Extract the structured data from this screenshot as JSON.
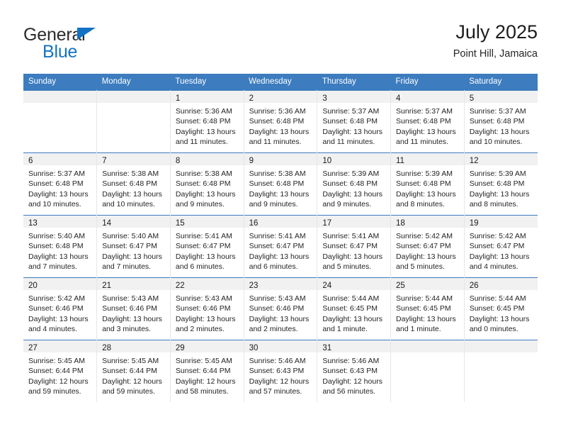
{
  "brand": {
    "line1": "General",
    "line2": "Blue",
    "triangle_color": "#1472c4",
    "text_color": "#2b2b2b"
  },
  "header": {
    "title": "July 2025",
    "subtitle": "Point Hill, Jamaica"
  },
  "theme": {
    "header_bg": "#3c7cbf",
    "header_text": "#ffffff",
    "daynum_band_bg": "#f1f1f1",
    "cell_bg": "#ffffff",
    "row_divider": "#3c7cbf",
    "col_divider": "#e6e6e6"
  },
  "weekday_headers": [
    "Sunday",
    "Monday",
    "Tuesday",
    "Wednesday",
    "Thursday",
    "Friday",
    "Saturday"
  ],
  "weeks": [
    [
      {
        "day": "",
        "empty": true,
        "sunrise": "",
        "sunset": "",
        "daylight_line1": "",
        "daylight_line2": ""
      },
      {
        "day": "",
        "empty": true,
        "sunrise": "",
        "sunset": "",
        "daylight_line1": "",
        "daylight_line2": ""
      },
      {
        "day": "1",
        "sunrise": "Sunrise: 5:36 AM",
        "sunset": "Sunset: 6:48 PM",
        "daylight_line1": "Daylight: 13 hours",
        "daylight_line2": "and 11 minutes."
      },
      {
        "day": "2",
        "sunrise": "Sunrise: 5:36 AM",
        "sunset": "Sunset: 6:48 PM",
        "daylight_line1": "Daylight: 13 hours",
        "daylight_line2": "and 11 minutes."
      },
      {
        "day": "3",
        "sunrise": "Sunrise: 5:37 AM",
        "sunset": "Sunset: 6:48 PM",
        "daylight_line1": "Daylight: 13 hours",
        "daylight_line2": "and 11 minutes."
      },
      {
        "day": "4",
        "sunrise": "Sunrise: 5:37 AM",
        "sunset": "Sunset: 6:48 PM",
        "daylight_line1": "Daylight: 13 hours",
        "daylight_line2": "and 11 minutes."
      },
      {
        "day": "5",
        "sunrise": "Sunrise: 5:37 AM",
        "sunset": "Sunset: 6:48 PM",
        "daylight_line1": "Daylight: 13 hours",
        "daylight_line2": "and 10 minutes."
      }
    ],
    [
      {
        "day": "6",
        "sunrise": "Sunrise: 5:37 AM",
        "sunset": "Sunset: 6:48 PM",
        "daylight_line1": "Daylight: 13 hours",
        "daylight_line2": "and 10 minutes."
      },
      {
        "day": "7",
        "sunrise": "Sunrise: 5:38 AM",
        "sunset": "Sunset: 6:48 PM",
        "daylight_line1": "Daylight: 13 hours",
        "daylight_line2": "and 10 minutes."
      },
      {
        "day": "8",
        "sunrise": "Sunrise: 5:38 AM",
        "sunset": "Sunset: 6:48 PM",
        "daylight_line1": "Daylight: 13 hours",
        "daylight_line2": "and 9 minutes."
      },
      {
        "day": "9",
        "sunrise": "Sunrise: 5:38 AM",
        "sunset": "Sunset: 6:48 PM",
        "daylight_line1": "Daylight: 13 hours",
        "daylight_line2": "and 9 minutes."
      },
      {
        "day": "10",
        "sunrise": "Sunrise: 5:39 AM",
        "sunset": "Sunset: 6:48 PM",
        "daylight_line1": "Daylight: 13 hours",
        "daylight_line2": "and 9 minutes."
      },
      {
        "day": "11",
        "sunrise": "Sunrise: 5:39 AM",
        "sunset": "Sunset: 6:48 PM",
        "daylight_line1": "Daylight: 13 hours",
        "daylight_line2": "and 8 minutes."
      },
      {
        "day": "12",
        "sunrise": "Sunrise: 5:39 AM",
        "sunset": "Sunset: 6:48 PM",
        "daylight_line1": "Daylight: 13 hours",
        "daylight_line2": "and 8 minutes."
      }
    ],
    [
      {
        "day": "13",
        "sunrise": "Sunrise: 5:40 AM",
        "sunset": "Sunset: 6:48 PM",
        "daylight_line1": "Daylight: 13 hours",
        "daylight_line2": "and 7 minutes."
      },
      {
        "day": "14",
        "sunrise": "Sunrise: 5:40 AM",
        "sunset": "Sunset: 6:47 PM",
        "daylight_line1": "Daylight: 13 hours",
        "daylight_line2": "and 7 minutes."
      },
      {
        "day": "15",
        "sunrise": "Sunrise: 5:41 AM",
        "sunset": "Sunset: 6:47 PM",
        "daylight_line1": "Daylight: 13 hours",
        "daylight_line2": "and 6 minutes."
      },
      {
        "day": "16",
        "sunrise": "Sunrise: 5:41 AM",
        "sunset": "Sunset: 6:47 PM",
        "daylight_line1": "Daylight: 13 hours",
        "daylight_line2": "and 6 minutes."
      },
      {
        "day": "17",
        "sunrise": "Sunrise: 5:41 AM",
        "sunset": "Sunset: 6:47 PM",
        "daylight_line1": "Daylight: 13 hours",
        "daylight_line2": "and 5 minutes."
      },
      {
        "day": "18",
        "sunrise": "Sunrise: 5:42 AM",
        "sunset": "Sunset: 6:47 PM",
        "daylight_line1": "Daylight: 13 hours",
        "daylight_line2": "and 5 minutes."
      },
      {
        "day": "19",
        "sunrise": "Sunrise: 5:42 AM",
        "sunset": "Sunset: 6:47 PM",
        "daylight_line1": "Daylight: 13 hours",
        "daylight_line2": "and 4 minutes."
      }
    ],
    [
      {
        "day": "20",
        "sunrise": "Sunrise: 5:42 AM",
        "sunset": "Sunset: 6:46 PM",
        "daylight_line1": "Daylight: 13 hours",
        "daylight_line2": "and 4 minutes."
      },
      {
        "day": "21",
        "sunrise": "Sunrise: 5:43 AM",
        "sunset": "Sunset: 6:46 PM",
        "daylight_line1": "Daylight: 13 hours",
        "daylight_line2": "and 3 minutes."
      },
      {
        "day": "22",
        "sunrise": "Sunrise: 5:43 AM",
        "sunset": "Sunset: 6:46 PM",
        "daylight_line1": "Daylight: 13 hours",
        "daylight_line2": "and 2 minutes."
      },
      {
        "day": "23",
        "sunrise": "Sunrise: 5:43 AM",
        "sunset": "Sunset: 6:46 PM",
        "daylight_line1": "Daylight: 13 hours",
        "daylight_line2": "and 2 minutes."
      },
      {
        "day": "24",
        "sunrise": "Sunrise: 5:44 AM",
        "sunset": "Sunset: 6:45 PM",
        "daylight_line1": "Daylight: 13 hours",
        "daylight_line2": "and 1 minute."
      },
      {
        "day": "25",
        "sunrise": "Sunrise: 5:44 AM",
        "sunset": "Sunset: 6:45 PM",
        "daylight_line1": "Daylight: 13 hours",
        "daylight_line2": "and 1 minute."
      },
      {
        "day": "26",
        "sunrise": "Sunrise: 5:44 AM",
        "sunset": "Sunset: 6:45 PM",
        "daylight_line1": "Daylight: 13 hours",
        "daylight_line2": "and 0 minutes."
      }
    ],
    [
      {
        "day": "27",
        "sunrise": "Sunrise: 5:45 AM",
        "sunset": "Sunset: 6:44 PM",
        "daylight_line1": "Daylight: 12 hours",
        "daylight_line2": "and 59 minutes."
      },
      {
        "day": "28",
        "sunrise": "Sunrise: 5:45 AM",
        "sunset": "Sunset: 6:44 PM",
        "daylight_line1": "Daylight: 12 hours",
        "daylight_line2": "and 59 minutes."
      },
      {
        "day": "29",
        "sunrise": "Sunrise: 5:45 AM",
        "sunset": "Sunset: 6:44 PM",
        "daylight_line1": "Daylight: 12 hours",
        "daylight_line2": "and 58 minutes."
      },
      {
        "day": "30",
        "sunrise": "Sunrise: 5:46 AM",
        "sunset": "Sunset: 6:43 PM",
        "daylight_line1": "Daylight: 12 hours",
        "daylight_line2": "and 57 minutes."
      },
      {
        "day": "31",
        "sunrise": "Sunrise: 5:46 AM",
        "sunset": "Sunset: 6:43 PM",
        "daylight_line1": "Daylight: 12 hours",
        "daylight_line2": "and 56 minutes."
      },
      {
        "day": "",
        "empty": true,
        "sunrise": "",
        "sunset": "",
        "daylight_line1": "",
        "daylight_line2": ""
      },
      {
        "day": "",
        "empty": true,
        "sunrise": "",
        "sunset": "",
        "daylight_line1": "",
        "daylight_line2": ""
      }
    ]
  ]
}
